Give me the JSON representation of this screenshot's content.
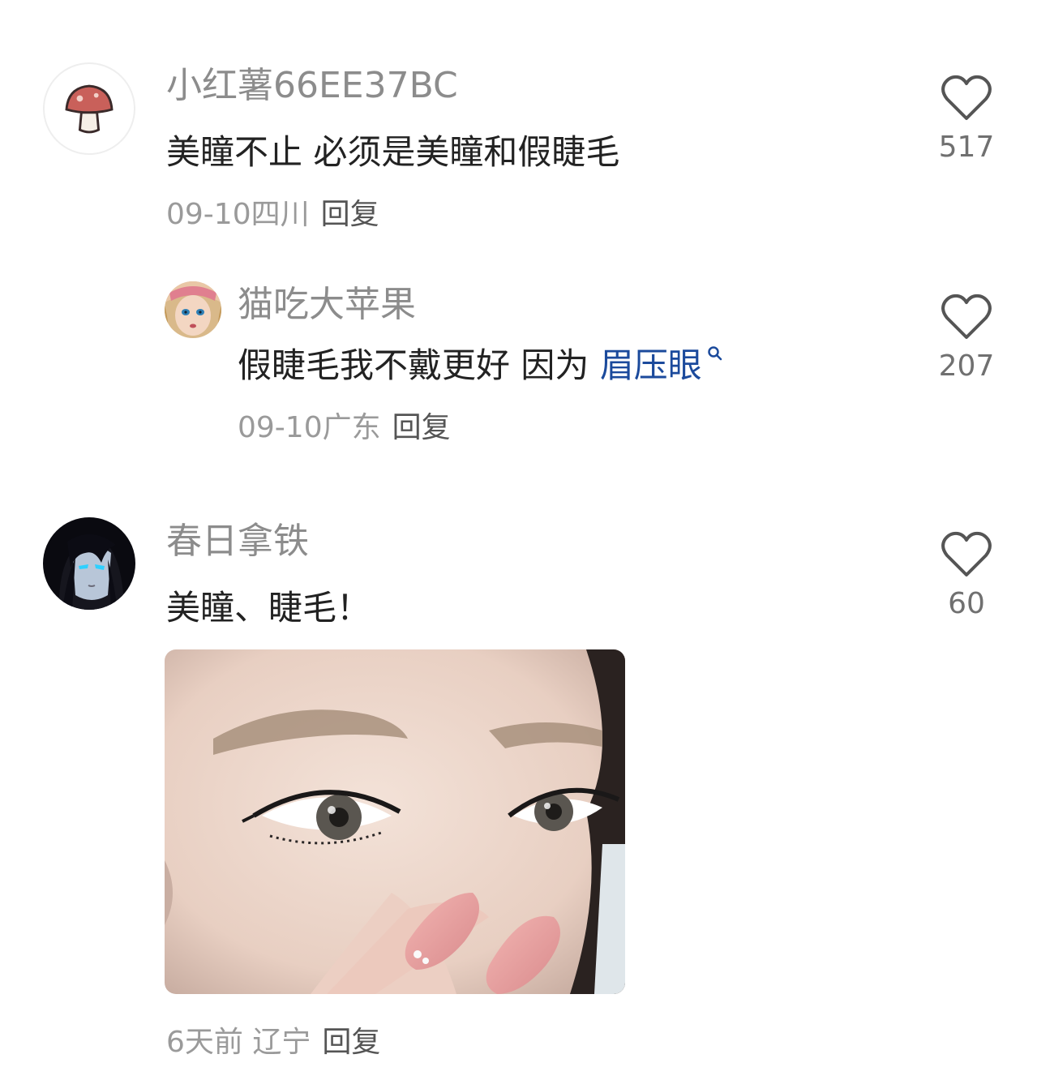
{
  "comments": [
    {
      "username": "小红薯66EE37BC",
      "text": "美瞳不止 必须是美瞳和假睫毛",
      "date": "09-10",
      "location": "四川",
      "reply_label": "回复",
      "likes": "517",
      "avatar_icon": "mushroom-icon",
      "replies": [
        {
          "username": "猫吃大苹果",
          "text_before_link": "假睫毛我不戴更好 因为 ",
          "link_text": "眉压眼",
          "date": "09-10",
          "location": "广东",
          "reply_label": "回复",
          "likes": "207",
          "avatar_icon": "doll-avatar"
        }
      ]
    },
    {
      "username": "春日拿铁",
      "text": "美瞳、睫毛！",
      "date": "6天前",
      "location": "辽宁",
      "reply_label": "回复",
      "likes": "60",
      "avatar_icon": "anime-girl-avatar",
      "image": "eye-makeup-photo"
    }
  ],
  "colors": {
    "username": "#8c8c8c",
    "text": "#222222",
    "meta": "#9a9a9a",
    "link": "#1b4a9c",
    "like_icon": "#555555"
  }
}
